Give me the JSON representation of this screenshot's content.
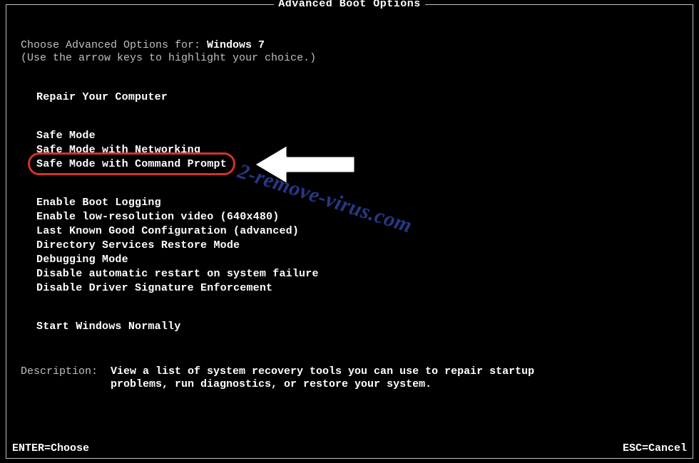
{
  "title": "Advanced Boot Options",
  "choose_prefix": "Choose Advanced Options for: ",
  "os_name": "Windows 7",
  "hint": "(Use the arrow keys to highlight your choice.)",
  "groups": [
    [
      "Repair Your Computer"
    ],
    [
      "Safe Mode",
      "Safe Mode with Networking",
      "Safe Mode with Command Prompt"
    ],
    [
      "Enable Boot Logging",
      "Enable low-resolution video (640x480)",
      "Last Known Good Configuration (advanced)",
      "Directory Services Restore Mode",
      "Debugging Mode",
      "Disable automatic restart on system failure",
      "Disable Driver Signature Enforcement"
    ],
    [
      "Start Windows Normally"
    ]
  ],
  "highlighted_option": "Safe Mode with Command Prompt",
  "description_label": "Description:",
  "description_text": "View a list of system recovery tools you can use to repair startup problems, run diagnostics, or restore your system.",
  "footer_left": "ENTER=Choose",
  "footer_right": "ESC=Cancel",
  "watermark": "2-remove-virus.com"
}
